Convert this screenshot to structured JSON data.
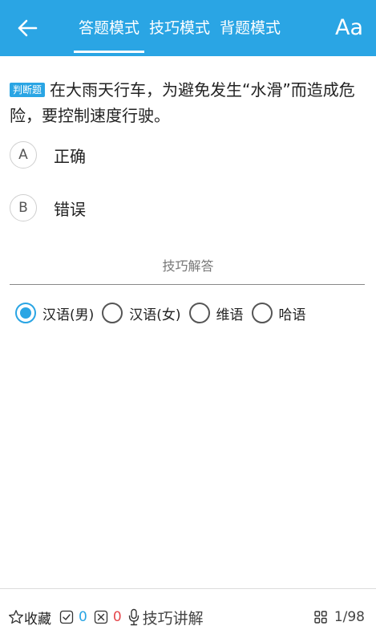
{
  "header": {
    "tabs": [
      {
        "label": "答题模式",
        "active": true
      },
      {
        "label": "技巧模式",
        "active": false
      },
      {
        "label": "背题模式",
        "active": false
      }
    ],
    "font_button": "Aa",
    "color": "#2aa5e4"
  },
  "question": {
    "type_badge": "判断题",
    "text": "在大雨天行车，为避免发生“水滑”而造成危险，要控制速度行驶。"
  },
  "options": [
    {
      "letter": "A",
      "text": "正确"
    },
    {
      "letter": "B",
      "text": "错误"
    }
  ],
  "skill": {
    "title": "技巧解答"
  },
  "voice_options": [
    {
      "label": "汉语(男)",
      "checked": true
    },
    {
      "label": "汉语(女)",
      "checked": false
    },
    {
      "label": "维语",
      "checked": false
    },
    {
      "label": "哈语",
      "checked": false
    }
  ],
  "footer": {
    "favorite_label": "收藏",
    "correct_count": "0",
    "wrong_count": "0",
    "explain_label": "技巧讲解",
    "progress": "1/98"
  },
  "icons": {
    "back": "arrow-left-icon",
    "star": "star-outline-icon",
    "check": "check-box-icon",
    "cross": "cross-box-icon",
    "mic": "microphone-icon",
    "grid": "grid-icon"
  }
}
